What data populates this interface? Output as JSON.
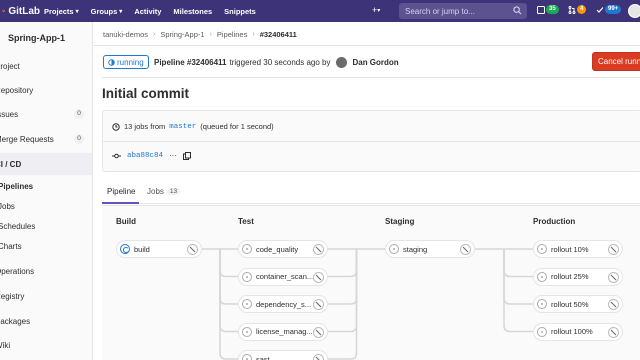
{
  "topnav": {
    "brand": "GitLab",
    "menu": [
      {
        "label": "Projects",
        "caret": true
      },
      {
        "label": "Groups",
        "caret": true
      },
      {
        "label": "Activity",
        "caret": false
      },
      {
        "label": "Milestones",
        "caret": false
      },
      {
        "label": "Snippets",
        "caret": false
      }
    ],
    "plus": "+",
    "search_placeholder": "Search or jump to...",
    "counters": [
      {
        "icon": "issues-icon",
        "value": "35",
        "color": "#1aaa55"
      },
      {
        "icon": "merge-request-icon",
        "value": "4",
        "color": "#fc9403"
      },
      {
        "icon": "todo-icon",
        "value": "99+",
        "color": "#1f78d1"
      }
    ]
  },
  "sidebar": {
    "project_name": "Spring-App-1",
    "items": [
      {
        "label": "Project",
        "count": ""
      },
      {
        "label": "Repository",
        "count": ""
      },
      {
        "label": "Issues",
        "count": "0"
      },
      {
        "label": "Merge Requests",
        "count": "0"
      },
      {
        "label": "CI / CD",
        "count": ""
      },
      {
        "label": "Pipelines",
        "count": ""
      },
      {
        "label": "Jobs",
        "count": ""
      },
      {
        "label": "Schedules",
        "count": ""
      },
      {
        "label": "Charts",
        "count": ""
      },
      {
        "label": "Operations",
        "count": ""
      },
      {
        "label": "Registry",
        "count": ""
      },
      {
        "label": "Packages",
        "count": ""
      },
      {
        "label": "Wiki",
        "count": ""
      }
    ]
  },
  "breadcrumb": [
    "tanuki-demos",
    "Spring-App-1",
    "Pipelines",
    "#32406411"
  ],
  "pipeline": {
    "status": "running",
    "title": "Pipeline #32406411",
    "triggered_text": "triggered 30 seconds ago by",
    "user": "Dan Gordon",
    "cancel_label": "Cancel running",
    "commit_title": "Initial commit",
    "jobs_prefix": "13 jobs from",
    "branch": "master",
    "queued": "(queued for 1 second)",
    "sha": "aba88c84",
    "more": "···"
  },
  "tabs": [
    {
      "label": "Pipeline",
      "count": ""
    },
    {
      "label": "Jobs",
      "count": "13"
    }
  ],
  "stages": [
    {
      "name": "Build",
      "jobs": [
        {
          "name": "build",
          "status": "running"
        }
      ]
    },
    {
      "name": "Test",
      "jobs": [
        {
          "name": "code_quality",
          "status": "created"
        },
        {
          "name": "container_scan...",
          "status": "created"
        },
        {
          "name": "dependency_s...",
          "status": "created"
        },
        {
          "name": "license_manag...",
          "status": "created"
        },
        {
          "name": "sast",
          "status": "created"
        }
      ]
    },
    {
      "name": "Staging",
      "jobs": [
        {
          "name": "staging",
          "status": "created"
        }
      ]
    },
    {
      "name": "Production",
      "jobs": [
        {
          "name": "rollout 10%",
          "status": "created"
        },
        {
          "name": "rollout 25%",
          "status": "created"
        },
        {
          "name": "rollout 50%",
          "status": "created"
        },
        {
          "name": "rollout 100%",
          "status": "created"
        }
      ]
    }
  ]
}
